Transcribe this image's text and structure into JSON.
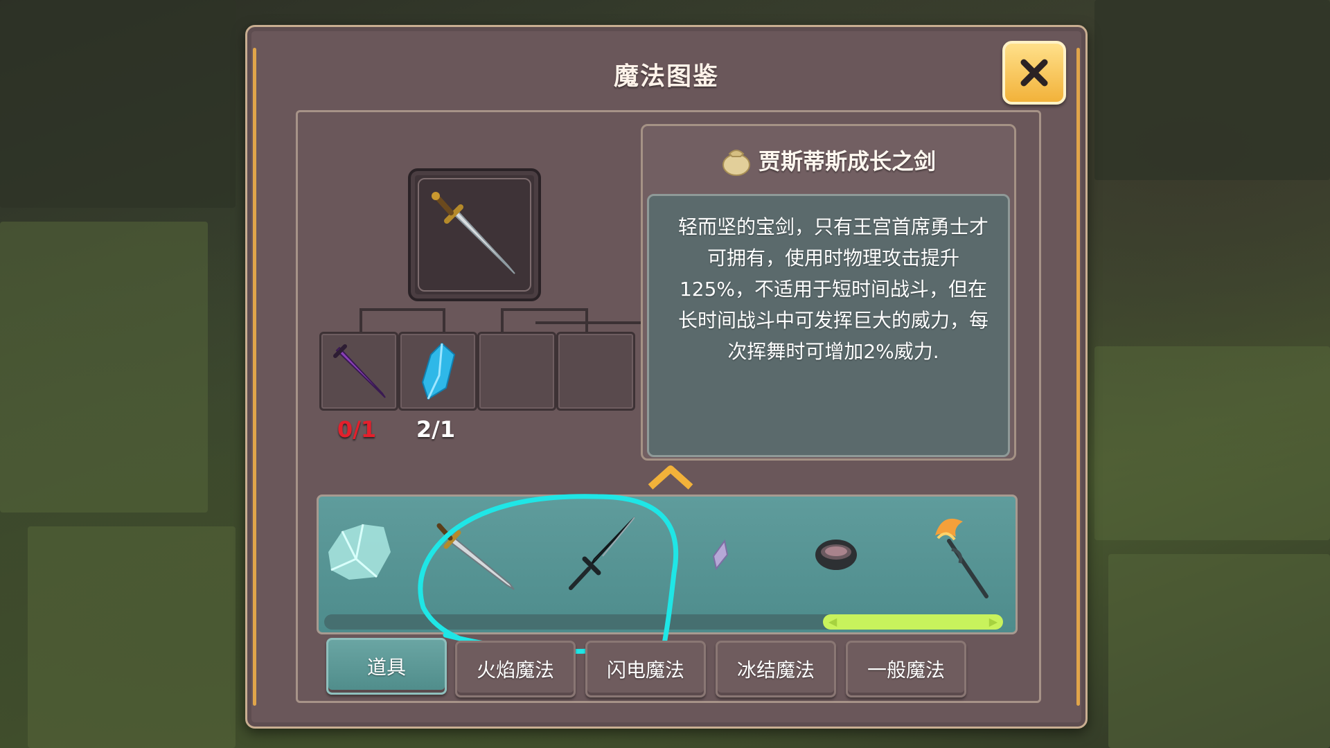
{
  "window": {
    "title": "魔法图鉴",
    "close_icon": "close-x-icon"
  },
  "recipe": {
    "result_icon": "golden-hilt-sword-icon",
    "materials": [
      {
        "icon": "purple-dagger-icon",
        "count": "0/1",
        "sufficient": false
      },
      {
        "icon": "blue-crystal-icon",
        "count": "2/1",
        "sufficient": true
      },
      {
        "icon": "",
        "count": ""
      },
      {
        "icon": "",
        "count": ""
      }
    ]
  },
  "detail": {
    "item_icon": "pouch-icon",
    "item_name": "贾斯蒂斯成长之剑",
    "description": "轻而坚的宝剑，只有王宫首席勇士才可拥有，使用时物理攻击提升125%，不适用于短时间战斗，但在长时间战斗中可发挥巨大的威力，每次挥舞时可增加2%威力."
  },
  "item_strip": {
    "scroll_up_icon": "chevron-up-icon",
    "items": [
      {
        "icon": "ice-crystal-icon"
      },
      {
        "icon": "golden-hilt-sword-icon"
      },
      {
        "icon": "dark-blade-sword-icon"
      },
      {
        "icon": "purple-shard-icon"
      },
      {
        "icon": "dark-bowl-icon"
      },
      {
        "icon": "flame-staff-icon"
      }
    ],
    "scroll_position": 0.85
  },
  "tabs": [
    {
      "label": "道具",
      "active": true
    },
    {
      "label": "火焰魔法",
      "active": false
    },
    {
      "label": "闪电魔法",
      "active": false
    },
    {
      "label": "冰结魔法",
      "active": false
    },
    {
      "label": "一般魔法",
      "active": false
    }
  ],
  "colors": {
    "accent_gold": "#f2b23a",
    "panel_brown": "#6a575a",
    "strip_teal": "#5f9c9c",
    "insufficient_red": "#e3202c",
    "scroll_thumb": "#c8f25c",
    "annotation_cyan": "#1fe6e6"
  }
}
